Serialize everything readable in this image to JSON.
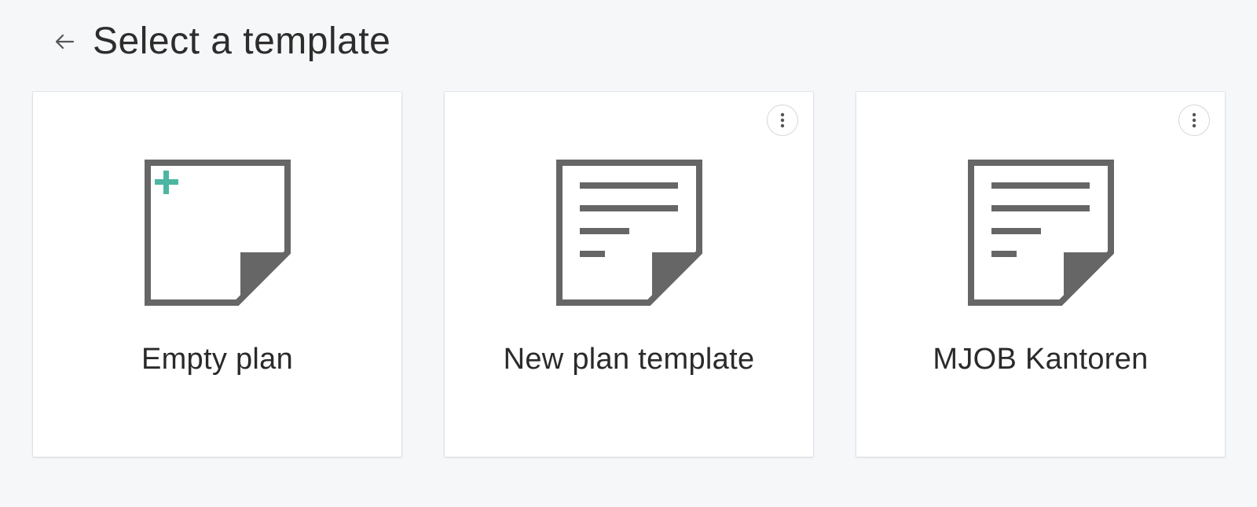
{
  "header": {
    "title": "Select a template",
    "back_icon": "arrow-left-icon"
  },
  "colors": {
    "background": "#f6f7f9",
    "card": "#ffffff",
    "icon_gray": "#666666",
    "plus_teal": "#4db6a2"
  },
  "templates": [
    {
      "label": "Empty plan",
      "icon": "empty-document-plus-icon",
      "has_menu": false
    },
    {
      "label": "New plan template",
      "icon": "document-lines-icon",
      "has_menu": true
    },
    {
      "label": "MJOB Kantoren",
      "icon": "document-lines-icon",
      "has_menu": true
    }
  ]
}
